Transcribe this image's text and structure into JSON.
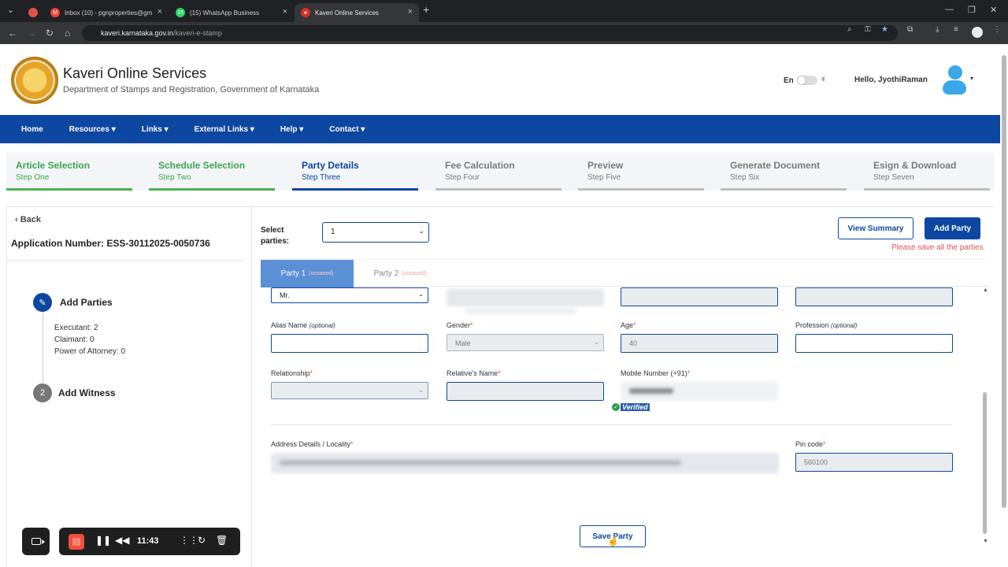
{
  "browser": {
    "tabs": [
      {
        "label": "Inbox (10) - pgnproperties@gm",
        "icon": "gmail-icon",
        "active": false
      },
      {
        "label": "(15) WhatsApp Business",
        "icon": "whatsapp-icon",
        "active": false
      },
      {
        "label": "Kaveri Online Services",
        "icon": "kaveri-icon",
        "active": true
      }
    ],
    "url_host": "kaveri.karnataka.gov.in",
    "url_path": "/kaveri-e-stamp"
  },
  "header": {
    "title": "Kaveri Online Services",
    "subtitle": "Department of Stamps and Registration, Government of Karnataka",
    "lang_en": "En",
    "lang_kn": "ಕ",
    "greeting": "Hello, JyothiRaman"
  },
  "nav": {
    "items": [
      "Home",
      "Resources ▾",
      "Links ▾",
      "External Links ▾",
      "Help ▾",
      "Contact ▾"
    ]
  },
  "stepper": {
    "steps": [
      {
        "title": "Article Selection",
        "sub": "Step One",
        "state": "done"
      },
      {
        "title": "Schedule Selection",
        "sub": "Step Two",
        "state": "done"
      },
      {
        "title": "Party Details",
        "sub": "Step Three",
        "state": "current"
      },
      {
        "title": "Fee Calculation",
        "sub": "Step Four",
        "state": "todo"
      },
      {
        "title": "Preview",
        "sub": "Step Five",
        "state": "todo"
      },
      {
        "title": "Generate Document",
        "sub": "Step Six",
        "state": "todo"
      },
      {
        "title": "Esign & Download",
        "sub": "Step Seven",
        "state": "todo"
      }
    ]
  },
  "left": {
    "back": "Back",
    "application_number": "Application Number: ESS-30112025-0050736",
    "add_parties": {
      "num": "✎",
      "label": "Add Parties"
    },
    "counts": [
      "Executant: 2",
      "Claimant: 0",
      "Power of Attorney: 0"
    ],
    "add_witness": {
      "num": "2",
      "label": "Add Witness"
    }
  },
  "right": {
    "select_label_1": "Select",
    "select_label_2": "parties:",
    "select_value": "1",
    "view_summary": "View Summary",
    "add_party": "Add Party",
    "warning": "Please save all the parties",
    "party_tabs": [
      {
        "label": "Party 1",
        "badge": "(unsaved)"
      },
      {
        "label": "Party 2",
        "badge": "(unsaved)"
      }
    ]
  },
  "form": {
    "salutation": "Mr.",
    "alias_label": "Alias Name",
    "alias_opt": "(optional)",
    "alias_value": "",
    "gender_label": "Gender",
    "gender_value": "Male",
    "age_label": "Age",
    "age_value": "40",
    "profession_label": "Profession",
    "profession_opt": "(optional)",
    "profession_value": "",
    "relationship_label": "Relationship",
    "relationship_value": "",
    "relative_label": "Relative's Name",
    "relative_value": "",
    "mobile_label": "Mobile Number (+91)",
    "verified": "Verified",
    "address_label": "Address Details / Locality",
    "pin_label": "Pin code",
    "pin_value": "560100",
    "required_mark": "*",
    "save_party": "Save Party"
  },
  "recorder": {
    "time": "11:43"
  },
  "colors": {
    "nav_blue": "#0d47a1",
    "done_green": "#4caf50",
    "warning_red": "#d9534f",
    "active_tab": "#5b8fd6"
  }
}
